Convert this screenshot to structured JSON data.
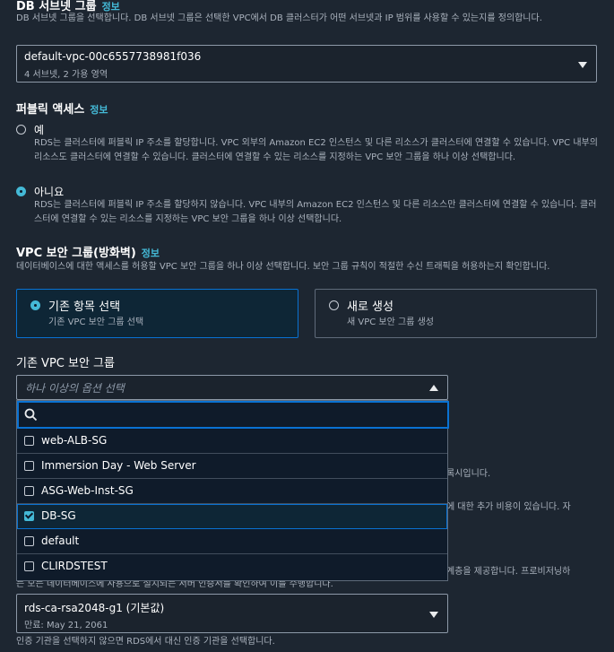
{
  "subnet_group": {
    "heading": "DB 서브넷 그룹",
    "info": "정보",
    "description": "DB 서브넷 그룹을 선택합니다. DB 서브넷 그룹은 선택한 VPC에서 DB 클러스터가 어떤 서브넷과 IP 범위를 사용할 수 있는지를 정의합니다.",
    "selected_value": "default-vpc-00c6557738981f036",
    "selected_sub": "4 서브넷, 2 가용 영역"
  },
  "public_access": {
    "heading": "퍼블릭 액세스",
    "info": "정보",
    "yes_label": "예",
    "yes_desc": "RDS는 클러스터에 퍼블릭 IP 주소를 할당합니다. VPC 외부의 Amazon EC2 인스턴스 및 다른 리소스가 클러스터에 연결할 수 있습니다. VPC 내부의 리소스도 클러스터에 연결할 수 있습니다. 클러스터에 연결할 수 있는 리소스를 지정하는 VPC 보안 그룹을 하나 이상 선택합니다.",
    "no_label": "아니요",
    "no_desc": "RDS는 클러스터에 퍼블릭 IP 주소를 할당하지 않습니다. VPC 내부의 Amazon EC2 인스턴스 및 다른 리소스만 클러스터에 연결할 수 있습니다. 클러스터에 연결할 수 있는 리소스를 지정하는 VPC 보안 그룹을 하나 이상 선택합니다."
  },
  "vpc_sg": {
    "heading": "VPC 보안 그룹(방화벽)",
    "info": "정보",
    "description": "데이터베이스에 대한 액세스를 허용할 VPC 보안 그룹을 하나 이상 선택합니다. 보안 그룹 규칙이 적절한 수신 트래픽을 허용하는지 확인합니다.",
    "existing_title": "기존 항목 선택",
    "existing_sub": "기존 VPC 보안 그룹 선택",
    "new_title": "새로 생성",
    "new_sub": "새 VPC 보안 그룹 생성"
  },
  "existing_sg": {
    "heading": "기존 VPC 보안 그룹",
    "placeholder": "하나 이상의 옵션 선택",
    "search_placeholder": "",
    "options": [
      {
        "label": "web-ALB-SG",
        "checked": false
      },
      {
        "label": "Immersion Day - Web Server",
        "checked": false
      },
      {
        "label": "ASG-Web-Inst-SG",
        "checked": false
      },
      {
        "label": "DB-SG",
        "checked": true
      },
      {
        "label": "default",
        "checked": false
      },
      {
        "label": "CLIRDSTEST",
        "checked": false
      }
    ]
  },
  "obscured": {
    "fragment1": "록시입니다.",
    "fragment2": "에 대한 추가 비용이 있습니다. 자",
    "fragment3": "계층을 제공합니다. 프로비저닝하",
    "fragment4": "는 모든 데이터베이스에 사용으로 설치되는 서버 인증서를 확인하여 이를 수행합니다."
  },
  "ca": {
    "selected_value": "rds-ca-rsa2048-g1 (기본값)",
    "selected_sub": "만료: May 21, 2061",
    "footer": "인증 기관을 선택하지 않으면 RDS에서 대신 인증 기관을 선택합니다."
  },
  "colors": {
    "background": "#1d2631",
    "accent": "#44b9d6",
    "selected_border": "#0972d3"
  }
}
